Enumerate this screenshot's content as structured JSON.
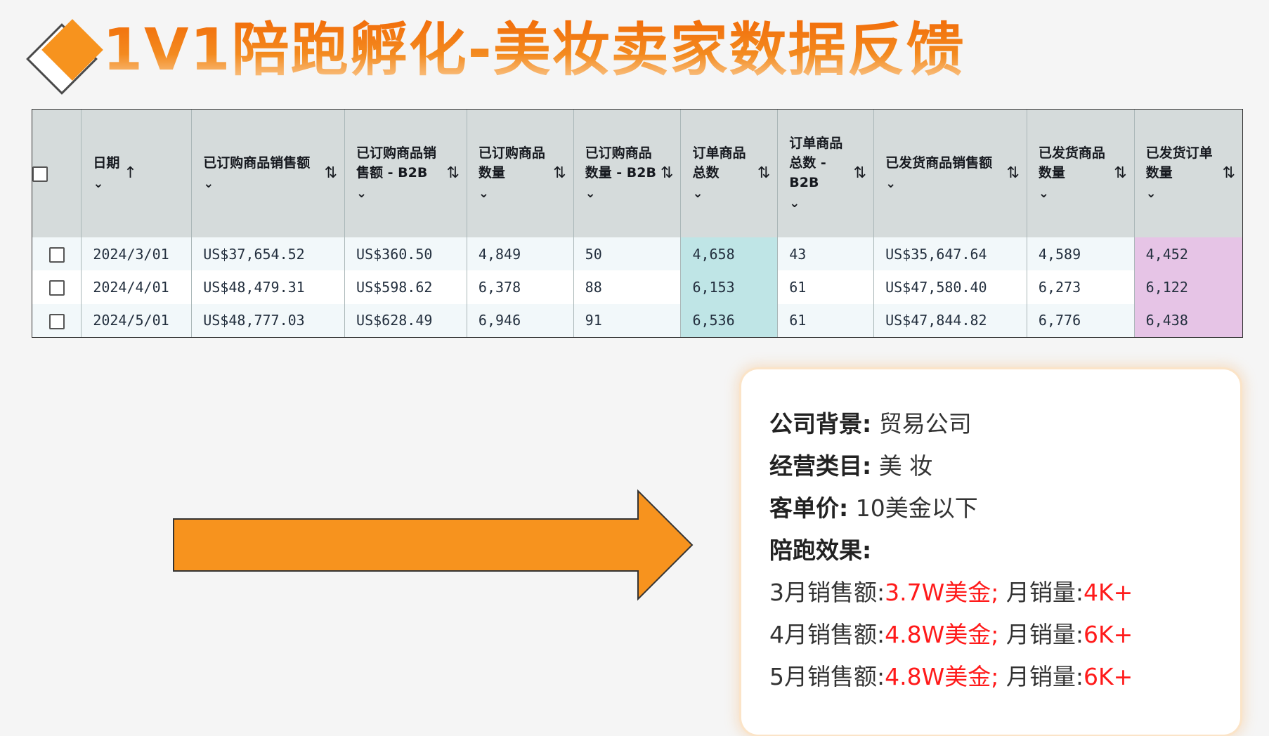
{
  "title": "1V1陪跑孵化-美妆卖家数据反馈",
  "table": {
    "headers": [
      {
        "label": "日期",
        "sort": "↑"
      },
      {
        "label": "已订购商品销售额",
        "sort": "⇅"
      },
      {
        "label": "已订购商品销售额 - B2B",
        "sort": "⇅"
      },
      {
        "label": "已订购商品数量",
        "sort": "⇅"
      },
      {
        "label": "已订购商品数量 - B2B",
        "sort": "⇅"
      },
      {
        "label": "订单商品总数",
        "sort": "⇅"
      },
      {
        "label": "订单商品总数 - B2B",
        "sort": "⇅"
      },
      {
        "label": "已发货商品销售额",
        "sort": "⇅"
      },
      {
        "label": "已发货商品数量",
        "sort": "⇅"
      },
      {
        "label": "已发货订单数量",
        "sort": "⇅"
      }
    ],
    "rows": [
      [
        "2024/3/01",
        "US$37,654.52",
        "US$360.50",
        "4,849",
        "50",
        "4,658",
        "43",
        "US$35,647.64",
        "4,589",
        "4,452"
      ],
      [
        "2024/4/01",
        "US$48,479.31",
        "US$598.62",
        "6,378",
        "88",
        "6,153",
        "61",
        "US$47,580.40",
        "6,273",
        "6,122"
      ],
      [
        "2024/5/01",
        "US$48,777.03",
        "US$628.49",
        "6,946",
        "91",
        "6,536",
        "61",
        "US$47,844.82",
        "6,776",
        "6,438"
      ]
    ],
    "highlight_colors": {
      "teal": "#bfe5e6",
      "pink": "#e6c4e6",
      "header_bg": "#d5dbdb"
    }
  },
  "card": {
    "company_label": "公司背景:",
    "company_value": "贸易公司",
    "category_label": "经营类目:",
    "category_value": "美 妆",
    "price_label": "客单价:",
    "price_value": "10美金以下",
    "effect_label": "陪跑效果:",
    "results": [
      {
        "month_label": "3月销售额:",
        "sales": "3.7W美金;",
        "volume_label": "月销量:",
        "volume": "4K+"
      },
      {
        "month_label": "4月销售额:",
        "sales": "4.8W美金;",
        "volume_label": "月销量:",
        "volume": "6K+"
      },
      {
        "month_label": "5月销售额:",
        "sales": "4.8W美金;",
        "volume_label": "月销量:",
        "volume": "6K+"
      }
    ]
  },
  "colors": {
    "accent": "#f7931e",
    "title_orange": "#f07c13",
    "highlight_red": "#ff1a1a"
  }
}
